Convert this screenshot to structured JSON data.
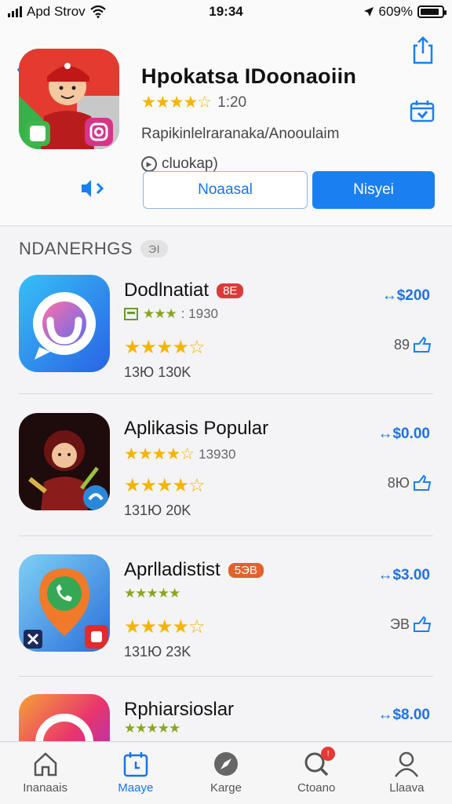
{
  "status": {
    "carrier": "Apd Strov",
    "time": "19:34",
    "battery": "609%"
  },
  "hero": {
    "title": "Hpokatsa IDoonaoiin",
    "rating_value": "1:20",
    "category": "Rapikinlelraranaka/Anooulaim",
    "meta": "cluokap)",
    "btn_secondary": "Noaasal",
    "btn_primary": "Nisyei"
  },
  "section": {
    "title": "NDANERHGS",
    "badge": "ЭI"
  },
  "apps": [
    {
      "name": "Dodlnatiat",
      "badge": "8E",
      "sub_count": ": 1930",
      "rating": 4.5,
      "count": "13Ю 130K",
      "price": "$200",
      "action": "89"
    },
    {
      "name": "Aplikasis Popular",
      "badge": "",
      "sub_count": "13930",
      "rating": 4.5,
      "count": "131Ю 20K",
      "price": "$0.00",
      "action": "8Ю"
    },
    {
      "name": "Aprlladistist",
      "badge": "5ЭB",
      "sub_count": "",
      "rating": 4.5,
      "count": "131Ю 23K",
      "price": "$3.00",
      "action": "ЭВ"
    },
    {
      "name": "Rphiarsioslar",
      "badge": "",
      "sub_count": "",
      "rating": 4.5,
      "count": "",
      "price": "$8.00",
      "action": ""
    }
  ],
  "tabs": [
    {
      "label": "Inanaais",
      "icon": "home-icon"
    },
    {
      "label": "Maaye",
      "icon": "calendar-icon"
    },
    {
      "label": "Karge",
      "icon": "compass-icon"
    },
    {
      "label": "Ctoano",
      "icon": "search-icon",
      "notification": "!"
    },
    {
      "label": "Llaava",
      "icon": "person-icon"
    }
  ],
  "colors": {
    "accent": "#1a7ff0",
    "star": "#f4b400",
    "badge_red": "#d93a3a",
    "badge_orange": "#e2622c"
  }
}
